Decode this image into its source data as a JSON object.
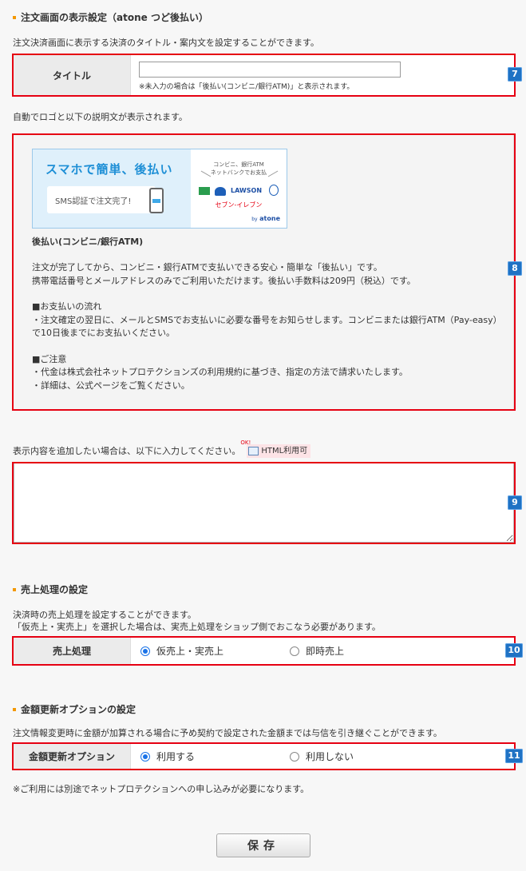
{
  "section1": {
    "title": "注文画面の表示設定（atone つど後払い）",
    "desc": "注文決済画面に表示する決済のタイトル・案内文を設定することができます。",
    "title_label": "タイトル",
    "title_value": "",
    "title_note": "※未入力の場合は「後払い(コンビニ/銀行ATM)」と表示されます。",
    "auto_desc": "自動でロゴと以下の説明文が表示されます。"
  },
  "preview": {
    "banner": {
      "headline": "スマホで簡単、後払い",
      "sms": "SMS認証で注文完了!",
      "right_line1": "コンビニ、銀行ATM",
      "right_line2": "ネットバンクでお支払",
      "lawson": "LAWSON",
      "seven": "セブン‐イレブン",
      "by": "by",
      "brand": "atone"
    },
    "name": "後払い(コンビニ/銀行ATM)",
    "p1": "注文が完了してから、コンビニ・銀行ATMで支払いできる安心・簡単な「後払い」です。",
    "p2": "携帯電話番号とメールアドレスのみでご利用いただけます。後払い手数料は209円（税込）です。",
    "flow_title": "■お支払いの流れ",
    "flow1": "・注文確定の翌日に、メールとSMSでお支払いに必要な番号をお知らせします。コンビニまたは銀行ATM（Pay-easy）",
    "flow2": "で10日後までにお支払いください。",
    "note_title": "■ご注意",
    "note1": "・代金は株式会社ネットプロテクションズの利用規約に基づき、指定の方法で請求いたします。",
    "note2": "・詳細は、公式ページをご覧ください。"
  },
  "extra": {
    "desc": "表示内容を追加したい場合は、以下に入力してください。",
    "ok": "OK!",
    "html_badge": "HTML利用可",
    "value": ""
  },
  "section2": {
    "title": "売上処理の設定",
    "desc1": "決済時の売上処理を設定することができます。",
    "desc2": "「仮売上・実売上」を選択した場合は、実売上処理をショップ側でおこなう必要があります。",
    "label": "売上処理",
    "opt1": "仮売上・実売上",
    "opt2": "即時売上",
    "selected": "仮売上・実売上"
  },
  "section3": {
    "title": "金額更新オプションの設定",
    "desc": "注文情報変更時に金額が加算される場合に予め契約で設定された金額までは与信を引き継ぐことができます。",
    "label": "金額更新オプション",
    "opt1": "利用する",
    "opt2": "利用しない",
    "selected": "利用する",
    "note": "※ご利用には別途でネットプロテクションへの申し込みが必要になります。"
  },
  "badges": {
    "b7": "7",
    "b8": "8",
    "b9": "9",
    "b10": "10",
    "b11": "11"
  },
  "save_label": "保存",
  "colors": {
    "accent_orange": "#f39800",
    "highlight_red": "#e60012",
    "badge_blue": "#1f72c4",
    "radio_blue": "#1a73e8",
    "banner_blue": "#1e8fd6"
  }
}
